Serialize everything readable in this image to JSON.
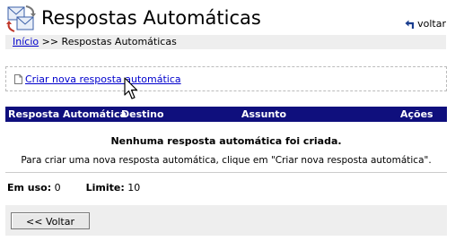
{
  "header": {
    "title": "Respostas Automáticas",
    "back_label": "voltar"
  },
  "breadcrumb": {
    "home": "Início",
    "separator": ">>",
    "current": "Respostas Automáticas"
  },
  "create": {
    "link_label": "Criar nova resposta automática"
  },
  "table": {
    "columns": [
      "Resposta Automática",
      "Destino",
      "Assunto",
      "Ações"
    ],
    "empty_title": "Nenhuma resposta automática foi criada.",
    "empty_desc": "Para criar uma nova resposta automática, clique em \"Criar nova resposta automática\"."
  },
  "usage": {
    "in_use_label": "Em uso:",
    "in_use_value": "0",
    "limit_label": "Limite:",
    "limit_value": "10"
  },
  "footer": {
    "back_button": "<< Voltar"
  },
  "colors": {
    "table_header_bg": "#0f0f7d",
    "link": "#0000cc",
    "bar_bg": "#eeeeee"
  }
}
